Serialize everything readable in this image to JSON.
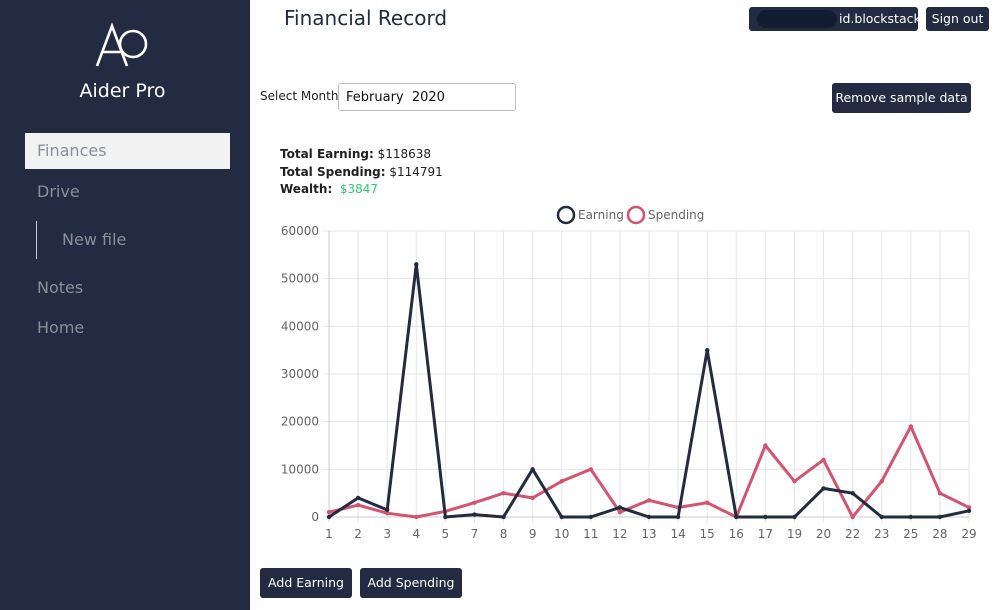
{
  "app": {
    "name": "Aider Pro",
    "logo_text": "AO"
  },
  "sidebar": {
    "items": [
      {
        "label": "Finances"
      },
      {
        "label": "Drive"
      },
      {
        "label": "New file"
      },
      {
        "label": "Notes"
      },
      {
        "label": "Home"
      }
    ]
  },
  "header": {
    "title": "Financial Record",
    "user_label": "id.blockstack",
    "signout_label": "Sign out"
  },
  "controls": {
    "month_label": "Select Month",
    "month_value": "February  2020",
    "remove_label": "Remove sample data"
  },
  "totals": {
    "earning_label": "Total Earning:",
    "earning_value": "$118638",
    "spending_label": "Total Spending:",
    "spending_value": "$114791",
    "wealth_label": "Wealth:",
    "wealth_value": "$3847"
  },
  "actions": {
    "add_earning_label": "Add Earning",
    "add_spending_label": "Add Spending"
  },
  "colors": {
    "sidebar": "#222b42",
    "earning": "#222b42",
    "spending": "#d4546f",
    "wealth": "#2ecc71"
  },
  "chart_data": {
    "type": "line",
    "categories": [
      "1",
      "2",
      "3",
      "4",
      "5",
      "7",
      "8",
      "9",
      "10",
      "11",
      "12",
      "13",
      "14",
      "15",
      "16",
      "17",
      "19",
      "20",
      "22",
      "23",
      "25",
      "28",
      "29"
    ],
    "series": [
      {
        "name": "Earning",
        "color": "#222b42",
        "values": [
          0,
          4000,
          1500,
          53000,
          0,
          500,
          0,
          10000,
          0,
          0,
          2000,
          0,
          0,
          35000,
          0,
          0,
          0,
          6000,
          5000,
          0,
          0,
          0,
          1300
        ]
      },
      {
        "name": "Spending",
        "color": "#d4546f",
        "values": [
          1000,
          2500,
          800,
          0,
          1200,
          3000,
          5000,
          4000,
          7500,
          10000,
          1000,
          3500,
          2000,
          3000,
          0,
          15000,
          7500,
          12000,
          0,
          7500,
          19000,
          5000,
          2000
        ]
      }
    ],
    "yticks": [
      "60000",
      "50000",
      "40000",
      "30000",
      "20000",
      "10000",
      "0"
    ],
    "ylim": [
      0,
      60000
    ],
    "grid": true,
    "legend": "top"
  }
}
